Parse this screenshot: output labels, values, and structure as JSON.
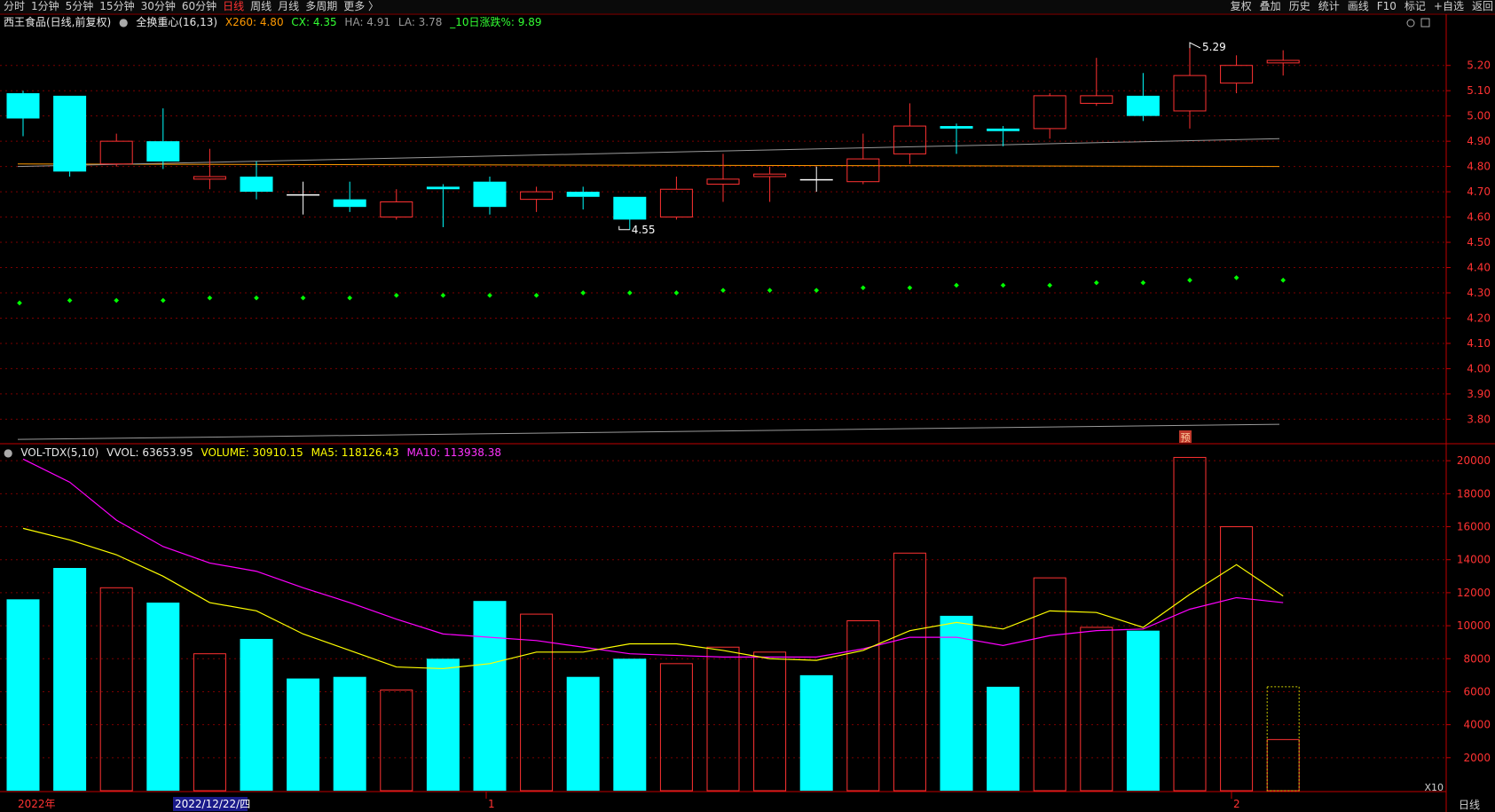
{
  "toolbar": {
    "left_tabs": [
      "分时",
      "1分钟",
      "5分钟",
      "15分钟",
      "30分钟",
      "60分钟",
      "日线",
      "周线",
      "月线",
      "多周期",
      "更多 〉"
    ],
    "active_tab": "日线",
    "right_tabs": [
      "复权",
      "叠加",
      "历史",
      "统计",
      "画线",
      "F10",
      "标记",
      "+自选",
      "返回"
    ]
  },
  "price_header": {
    "title": "西王食品(日线,前复权)",
    "indicator": "全换重心(16,13)",
    "x260": "X260: 4.80",
    "cx": "CX: 4.35",
    "ha": "HA: 4.91",
    "la": "LA: 3.78",
    "chg10": "_10日涨跌%: 9.89"
  },
  "volume_header": {
    "name": "VOL-TDX(5,10)",
    "vvol": "VVOL: 63653.95",
    "volume": "VOLUME: 30910.15",
    "ma5": "MA5: 118126.43",
    "ma10": "MA10: 113938.38"
  },
  "colors": {
    "up": "#ff3232",
    "down": "#00ffff",
    "ma5": "#ffff00",
    "ma10": "#ff00ff",
    "x260": "#ff9900",
    "grid": "#7a0000",
    "dots": "#00ff00"
  },
  "markers": {
    "high_label": "5.29",
    "low_label": "4.55",
    "pre_badge": "预",
    "multiplier": "X10",
    "period": "日线"
  },
  "x_axis_labels": {
    "year": "2022年",
    "date": "2022/12/22/四",
    "m1": "1",
    "m2": "2"
  },
  "chart_data": [
    {
      "type": "candlestick",
      "y_ticks": [
        3.8,
        3.9,
        4.0,
        4.1,
        4.2,
        4.3,
        4.4,
        4.5,
        4.6,
        4.7,
        4.8,
        4.9,
        5.0,
        5.1,
        5.2
      ],
      "ylim": [
        3.71,
        5.35
      ],
      "candles": [
        {
          "o": 5.09,
          "h": 5.1,
          "l": 4.92,
          "c": 4.99
        },
        {
          "o": 5.08,
          "h": 5.08,
          "l": 4.76,
          "c": 4.78
        },
        {
          "o": 4.81,
          "h": 4.93,
          "l": 4.8,
          "c": 4.9
        },
        {
          "o": 4.9,
          "h": 5.03,
          "l": 4.79,
          "c": 4.82
        },
        {
          "o": 4.75,
          "h": 4.87,
          "l": 4.71,
          "c": 4.76
        },
        {
          "o": 4.76,
          "h": 4.82,
          "l": 4.67,
          "c": 4.7
        },
        {
          "o": 4.69,
          "h": 4.74,
          "l": 4.61,
          "c": 4.69
        },
        {
          "o": 4.67,
          "h": 4.74,
          "l": 4.62,
          "c": 4.64
        },
        {
          "o": 4.6,
          "h": 4.71,
          "l": 4.59,
          "c": 4.66
        },
        {
          "o": 4.72,
          "h": 4.73,
          "l": 4.56,
          "c": 4.71
        },
        {
          "o": 4.74,
          "h": 4.76,
          "l": 4.61,
          "c": 4.64
        },
        {
          "o": 4.67,
          "h": 4.72,
          "l": 4.62,
          "c": 4.7
        },
        {
          "o": 4.7,
          "h": 4.72,
          "l": 4.63,
          "c": 4.68
        },
        {
          "o": 4.68,
          "h": 4.68,
          "l": 4.55,
          "c": 4.59
        },
        {
          "o": 4.6,
          "h": 4.76,
          "l": 4.59,
          "c": 4.71
        },
        {
          "o": 4.73,
          "h": 4.85,
          "l": 4.66,
          "c": 4.75
        },
        {
          "o": 4.76,
          "h": 4.8,
          "l": 4.66,
          "c": 4.77
        },
        {
          "o": 4.75,
          "h": 4.8,
          "l": 4.7,
          "c": 4.75
        },
        {
          "o": 4.74,
          "h": 4.93,
          "l": 4.73,
          "c": 4.83
        },
        {
          "o": 4.85,
          "h": 5.05,
          "l": 4.81,
          "c": 4.96
        },
        {
          "o": 4.96,
          "h": 4.97,
          "l": 4.85,
          "c": 4.95
        },
        {
          "o": 4.95,
          "h": 4.96,
          "l": 4.88,
          "c": 4.94
        },
        {
          "o": 4.95,
          "h": 5.09,
          "l": 4.91,
          "c": 5.08
        },
        {
          "o": 5.05,
          "h": 5.23,
          "l": 5.04,
          "c": 5.08
        },
        {
          "o": 5.08,
          "h": 5.17,
          "l": 4.98,
          "c": 5.0
        },
        {
          "o": 5.02,
          "h": 5.29,
          "l": 4.95,
          "c": 5.16
        },
        {
          "o": 5.13,
          "h": 5.24,
          "l": 5.09,
          "c": 5.2
        },
        {
          "o": 5.21,
          "h": 5.26,
          "l": 5.16,
          "c": 5.22
        }
      ],
      "x260_line": {
        "y_start": 4.81,
        "y_end": 4.8
      },
      "ha_line": {
        "y_start": 4.8,
        "y_end": 4.91
      },
      "la_line": {
        "y_start": 3.72,
        "y_end": 3.78
      },
      "cx_dots": [
        4.26,
        4.27,
        4.27,
        4.27,
        4.28,
        4.28,
        4.28,
        4.28,
        4.29,
        4.29,
        4.29,
        4.29,
        4.3,
        4.3,
        4.3,
        4.31,
        4.31,
        4.31,
        4.32,
        4.32,
        4.33,
        4.33,
        4.33,
        4.34,
        4.34,
        4.35,
        4.36,
        4.35
      ]
    },
    {
      "type": "volume_bar",
      "y_ticks": [
        2000,
        4000,
        6000,
        8000,
        10000,
        12000,
        14000,
        16000,
        18000,
        20000
      ],
      "ylim": [
        0,
        20600
      ],
      "volumes": [
        11600,
        13500,
        12300,
        11400,
        8300,
        9200,
        6800,
        6900,
        6100,
        8000,
        11500,
        10700,
        6900,
        8000,
        7700,
        8700,
        8400,
        7000,
        10300,
        14400,
        10600,
        6300,
        12900,
        9900,
        9700,
        20200,
        16000,
        3100
      ],
      "pre_volume": 6300,
      "ma5": [
        15900,
        15200,
        14300,
        13000,
        11400,
        10900,
        9500,
        8500,
        7500,
        7400,
        7700,
        8400,
        8400,
        8900,
        8900,
        8500,
        8000,
        7900,
        8500,
        9700,
        10200,
        9800,
        10900,
        10800,
        9900,
        11900,
        13700,
        11800
      ],
      "ma10": [
        20100,
        18700,
        16400,
        14800,
        13800,
        13300,
        12300,
        11400,
        10400,
        9500,
        9300,
        9100,
        8700,
        8300,
        8200,
        8100,
        8100,
        8100,
        8600,
        9300,
        9300,
        8800,
        9400,
        9700,
        9800,
        11000,
        11700,
        11400
      ]
    }
  ]
}
